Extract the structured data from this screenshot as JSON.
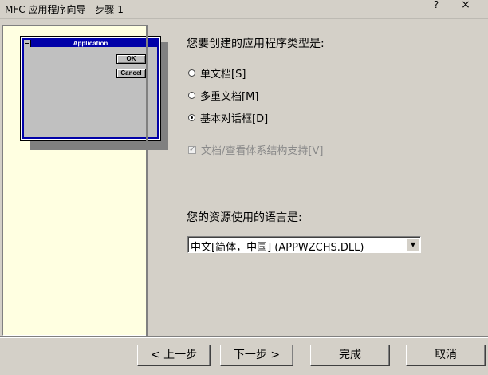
{
  "window": {
    "title": "MFC 应用程序向导 - 步骤 1",
    "help_glyph": "?",
    "close_glyph": "×"
  },
  "preview": {
    "title": "Application",
    "ok_label": "OK",
    "cancel_label": "Cancel"
  },
  "main": {
    "question": "您要创建的应用程序类型是:",
    "options": [
      {
        "label": "单文档[S]",
        "selected": false
      },
      {
        "label": "多重文档[M]",
        "selected": false
      },
      {
        "label": "基本对话框[D]",
        "selected": true
      }
    ],
    "docview_checkbox": {
      "label": "文档/查看体系结构支持[V]",
      "checked": true,
      "enabled": false
    },
    "language_label": "您的资源使用的语言是:",
    "language_value": "中文[简体，中国] (APPWZCHS.DLL)"
  },
  "buttons": {
    "back": "< 上一步",
    "next": "下一步 >",
    "finish": "完成",
    "cancel": "取消"
  }
}
